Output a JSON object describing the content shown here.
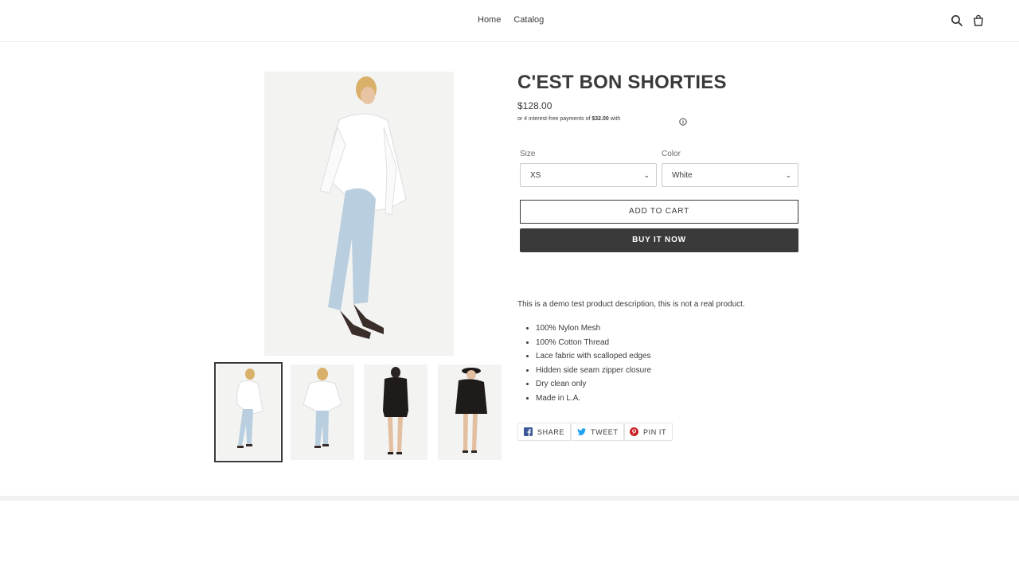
{
  "header": {
    "nav": [
      "Home",
      "Catalog"
    ],
    "icons": [
      "search-icon",
      "cart-icon"
    ]
  },
  "product": {
    "title": "C'EST BON SHORTIES",
    "price": "$128.00",
    "installments": {
      "prefix": "or 4 interest-free payments of ",
      "amount": "$32.00",
      "suffix": " with"
    },
    "size": {
      "label": "Size",
      "value": "XS"
    },
    "color": {
      "label": "Color",
      "value": "White"
    },
    "add_to_cart": "ADD TO CART",
    "buy_now": "BUY IT NOW",
    "description": "This is a demo test product description, this is not a real product.",
    "features": [
      "100% Nylon Mesh",
      "100% Cotton Thread",
      "Lace fabric with scalloped edges",
      "Hidden side seam zipper closure",
      "Dry clean only",
      "Made in L.A."
    ],
    "share": {
      "facebook": "SHARE",
      "twitter": "TWEET",
      "pinterest": "PIN IT"
    }
  },
  "colors": {
    "text": "#3a3a3a",
    "button_dark": "#3a3a3a",
    "facebook": "#3b5998",
    "twitter": "#1da1f2",
    "pinterest": "#cb2027"
  }
}
